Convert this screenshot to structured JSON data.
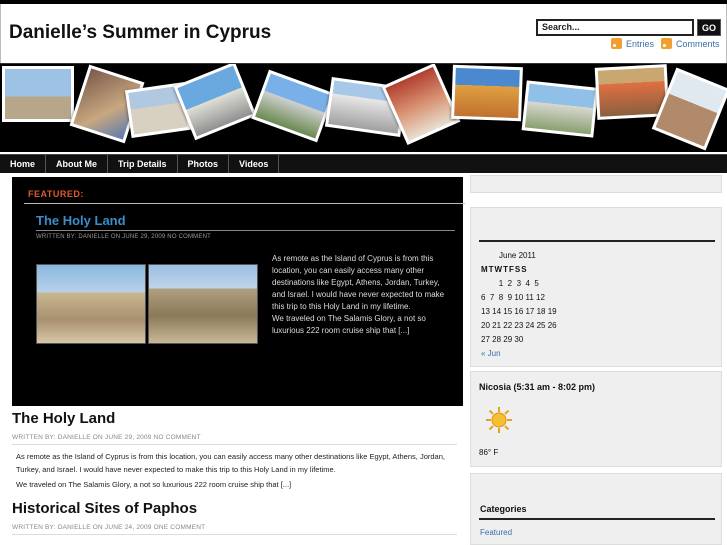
{
  "header": {
    "site_title": "Danielle’s Summer in Cyprus",
    "search_placeholder": "Search...",
    "search_button": "GO",
    "entries_link": "Entries",
    "comments_link": "Comments"
  },
  "nav": {
    "items": [
      "Home",
      "About Me",
      "Trip Details",
      "Photos",
      "Videos"
    ]
  },
  "featured": {
    "label": "FEATURED:",
    "title": "The Holy Land",
    "meta": "WRITTEN BY: DANIELLE ON JUNE 29, 2009    NO COMMENT",
    "excerpt": "As remote as the Island of Cyprus is from this location, you can easily access many other destinations like Egypt, Athens, Jordan, Turkey, and Israel. I would have never expected to make this trip to this Holy Land in my lifetime.\nWe traveled on The Salamis Glory, a not so luxurious 222 room cruise ship that [...]"
  },
  "posts": [
    {
      "title": "The Holy Land",
      "meta": "WRITTEN BY: DANIELLE ON JUNE 29, 2009    NO COMMENT",
      "body1": "As remote as the Island of Cyprus is from this location, you can easily access many other destinations like Egypt, Athens, Jordan, Turkey, and Israel. I would have never expected to make this trip to this Holy Land in my lifetime.",
      "body2": "We traveled on The Salamis Glory, a not so luxurious 222 room cruise ship that [...]"
    },
    {
      "title": "Historical Sites of Paphos",
      "meta": "WRITTEN BY: DANIELLE ON JUNE 24, 2009    ONE COMMENT"
    }
  ],
  "calendar": {
    "title": "June 2011",
    "weekdays": "MTWTFSS",
    "rows": [
      "        1  2  3  4  5",
      "6  7  8  9 10 11 12",
      "13 14 15 16 17 18 19",
      "20 21 22 23 24 25 26",
      "27 28 29 30"
    ],
    "prev_link": "« Jun"
  },
  "weather": {
    "title": "Nicosia (5:31 am - 8:02 pm)",
    "temp": "86° F",
    "icon": "sun-icon"
  },
  "categories": {
    "title": "Categories",
    "first": "Featured"
  }
}
